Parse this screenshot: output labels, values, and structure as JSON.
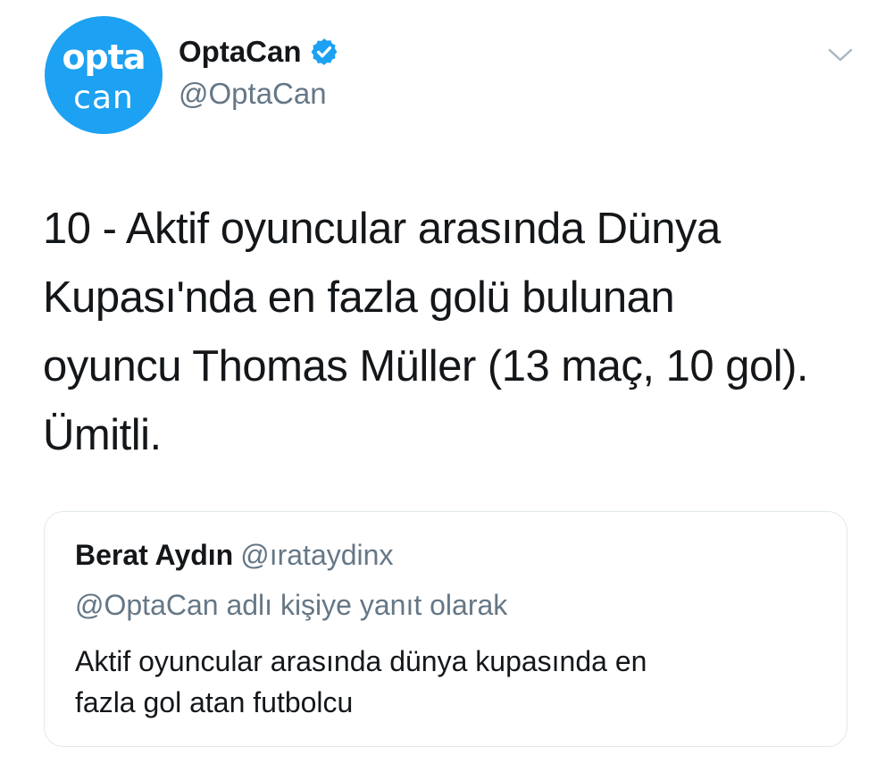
{
  "tweet": {
    "avatar": {
      "line1": "opta",
      "line2": "can",
      "color": "#1da1f2"
    },
    "author": {
      "display_name": "OptaCan",
      "handle": "@OptaCan",
      "verified": true,
      "verified_color": "#1da1f2"
    },
    "menu_icon": "chevron-down-icon",
    "text_lines": [
      "10 - Aktif oyuncular arasında Dünya",
      "Kupası'nda en fazla golü bulunan",
      "oyuncu Thomas Müller (13 maç, 10 gol).",
      "Ümitli."
    ],
    "quoted": {
      "display_name": "Berat Aydın",
      "handle": "@ırataydinx",
      "reply_context": "@OptaCan adlı kişiye yanıt olarak",
      "text_lines": [
        "Aktif oyuncular arasında dünya kupasında en",
        "fazla gol atan futbolcu"
      ]
    }
  }
}
